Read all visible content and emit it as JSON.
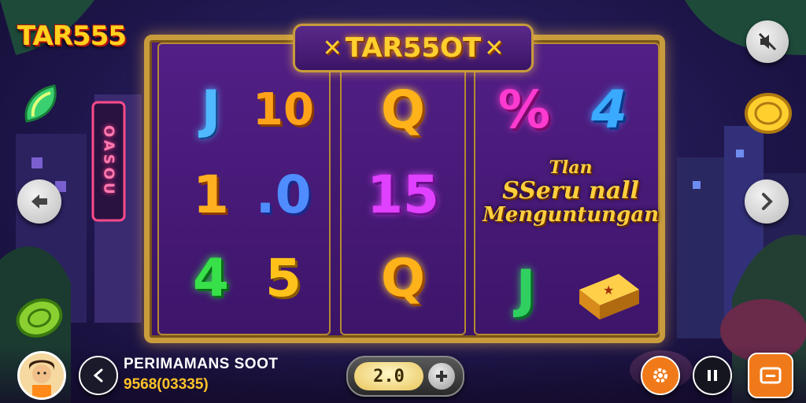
{
  "header": {
    "logo": "TAR555",
    "title": "TAR55OT"
  },
  "reels": [
    {
      "symbols": [
        "J",
        "10",
        "1",
        ".0",
        "4",
        "5"
      ]
    },
    {
      "symbols": [
        "Q",
        "15",
        "Q"
      ]
    },
    {
      "symbols": [
        "%",
        "4",
        "J"
      ]
    }
  ],
  "promo": {
    "line1": "Tlan",
    "line2": "SSeru nall",
    "line3": "Menguntungan"
  },
  "neon_sign": "OASOU",
  "footer": {
    "game_name": "PERIMAMANS SOOT",
    "game_sub": "9568(03335)",
    "bet_value": "2.0"
  },
  "icons": {
    "mute": "mute-icon",
    "back": "back-arrow-icon",
    "next": "chevron-right-icon",
    "share": "share-icon",
    "settings": "gear-icon",
    "pause": "pause-icon",
    "menu": "menu-icon",
    "plus": "plus-icon"
  },
  "colors": {
    "gold": "#ffcf2e",
    "frame": "#c89b3c",
    "reel_bg": "#4b1d78",
    "settings_btn": "#f07a1a",
    "menu_btn": "#f07a1a"
  }
}
